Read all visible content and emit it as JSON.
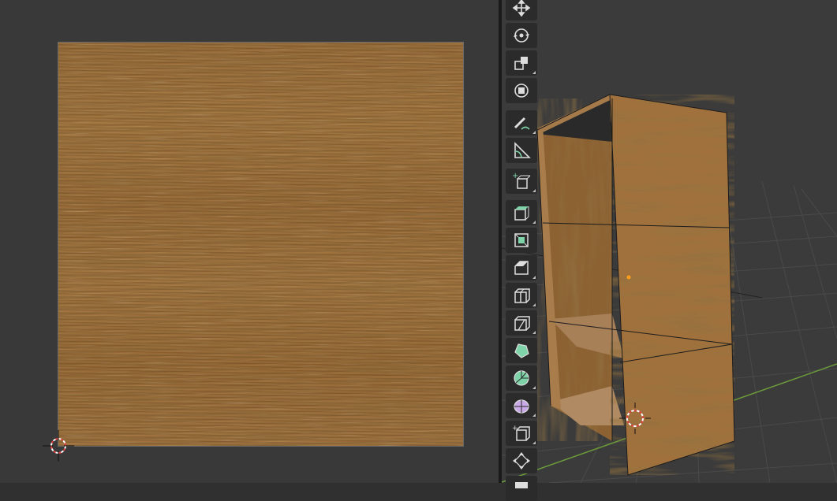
{
  "editor": {
    "left_panel": "uv-image-editor",
    "right_panel": "3d-viewport",
    "texture": "wood-texture",
    "colors": {
      "background_dark": "#303030",
      "uv_bg": "#393939",
      "viewport_bg": "#3b3b3b",
      "toolbar_bg": "#2b2b2b",
      "x_axis": "#b8454f",
      "y_axis": "#6b9b3a",
      "wood": "#9e703d",
      "cursor_red": "#e04040"
    }
  },
  "toolbar": {
    "tools": [
      {
        "name": "move-tool",
        "icon": "move-arrows-icon"
      },
      {
        "name": "rotate-tool",
        "icon": "rotate-icon"
      },
      {
        "name": "scale-tool",
        "icon": "scale-icon"
      },
      {
        "name": "transform-tool",
        "icon": "transform-icon"
      },
      {
        "name": "annotate-tool",
        "icon": "pencil-icon"
      },
      {
        "name": "measure-tool",
        "icon": "ruler-icon"
      },
      {
        "name": "add-cube-tool",
        "icon": "add-cube-icon"
      },
      {
        "name": "extrude-tool",
        "icon": "extrude-region-icon"
      },
      {
        "name": "inset-tool",
        "icon": "inset-faces-icon"
      },
      {
        "name": "bevel-tool",
        "icon": "bevel-icon"
      },
      {
        "name": "loop-cut-tool",
        "icon": "loop-cut-icon"
      },
      {
        "name": "knife-tool",
        "icon": "knife-icon"
      },
      {
        "name": "poly-build-tool",
        "icon": "poly-build-icon"
      },
      {
        "name": "spin-tool",
        "icon": "spin-icon"
      },
      {
        "name": "smooth-tool",
        "icon": "smooth-icon"
      },
      {
        "name": "edge-slide-tool",
        "icon": "edge-slide-icon"
      },
      {
        "name": "shrink-fatten-tool",
        "icon": "shrink-fatten-icon"
      }
    ]
  }
}
